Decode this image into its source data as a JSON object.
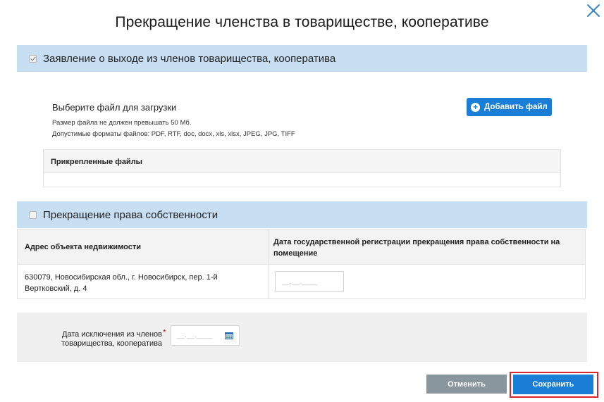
{
  "modal": {
    "title": "Прекращение членства в товариществе, кооперативе",
    "close_icon": "close-icon"
  },
  "section_application": {
    "checked": true,
    "label": "Заявление о выходе из членов товарищества, кооператива"
  },
  "upload": {
    "title": "Выберите файл для загрузки",
    "size_note": "Размер файла не должен превышать 50 Мб.",
    "formats_note": "Допустимые форматы файлов: PDF, RTF, doc, docx, xls, xlsx, JPEG, JPG, TIFF",
    "add_button_label": "Добавить файл",
    "add_button_icon": "plus-circle-icon"
  },
  "attached_files": {
    "header": "Прикрепленные файлы",
    "rows": []
  },
  "section_ownership": {
    "checked": false,
    "label": "Прекращение права собственности"
  },
  "property_table": {
    "columns": [
      "Адрес объекта недвижимости",
      "Дата государственной регистрации прекращения права собственности на помещение"
    ],
    "rows": [
      {
        "address": "630079, Новосибирская обл., г. Новосибирск, пер. 1-й Вертковский, д. 4",
        "date_mask": "__.__.____"
      }
    ]
  },
  "exclusion": {
    "label": "Дата исключения из членов товарищества, кооператива",
    "required_mark": "*",
    "date_mask": "__.__.____",
    "calendar_icon": "calendar-icon"
  },
  "footer": {
    "cancel_label": "Отменить",
    "save_label": "Сохранить"
  },
  "colors": {
    "section_header_bg": "#c8def2",
    "primary": "#1a7ed6",
    "secondary_button": "#8a969e",
    "highlight": "#d9262c"
  }
}
